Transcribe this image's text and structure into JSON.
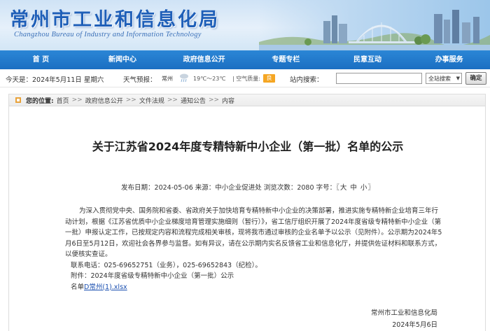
{
  "header": {
    "title": "常州市工业和信息化局",
    "subtitle": "Changzhou Bureau of Industry and Information Technology"
  },
  "nav": {
    "items": [
      {
        "label": "首 页"
      },
      {
        "label": "新闻中心"
      },
      {
        "label": "政府信息公开"
      },
      {
        "label": "专题专栏"
      },
      {
        "label": "民意互动"
      },
      {
        "label": "办事服务"
      }
    ]
  },
  "info": {
    "date": "今天是：2024年5月11日 星期六",
    "weather_label": "天气预报：",
    "city": "常州",
    "temperature": "19℃～23℃",
    "aqi_label": "空气质量:",
    "aqi_value": "良",
    "search_label": "站内搜索：",
    "search_value": "",
    "search_scope": "全站搜索",
    "search_button": "确定"
  },
  "breadcrumb": {
    "label": "您的位置:",
    "items": [
      "首页",
      "政府信息公开",
      "文件法规",
      "通知公告",
      "内容"
    ]
  },
  "article": {
    "title": "关于江苏省2024年度专精特新中小企业（第一批）名单的公示",
    "meta_publish": "发布日期：2024-05-06",
    "meta_source": "来源：中小企业促进处",
    "meta_views": "浏览次数：2080",
    "meta_size_label": "字号：〖",
    "size_big": "大",
    "size_mid": "中",
    "size_small": "小",
    "meta_size_end": "〗",
    "body_p1": "为深入贯彻党中央、国务院和省委、省政府关于加快培育专精特新中小企业的决策部署，推进实施专精特新企业培育三年行动计划，根据《江苏省优质中小企业梯度培育管理实施细则（暂行）》，省工信厅组织开展了2024年度省级专精特新中小企业（第一批）申报认定工作，已按规定内容和流程完成相关审核，现将我市通过审核的企业名单予以公示（见附件）。公示期为2024年5月6日至5月12日，欢迎社会各界参与监督。如有异议，请在公示期内实名反馈省工业和信息化厅，并提供佐证材料和联系方式，以便核实查证。",
    "contact": "联系电话：025-69652751（业务），025-69652843（纪检）。",
    "attachment": "附件：2024年度省级专精特新中小企业（第一批）公示",
    "filename_prefix": "名单",
    "filename_link": "D常州(1).xlsx",
    "sign_org": "常州市工业和信息化局",
    "sign_date": "2024年5月6日"
  }
}
